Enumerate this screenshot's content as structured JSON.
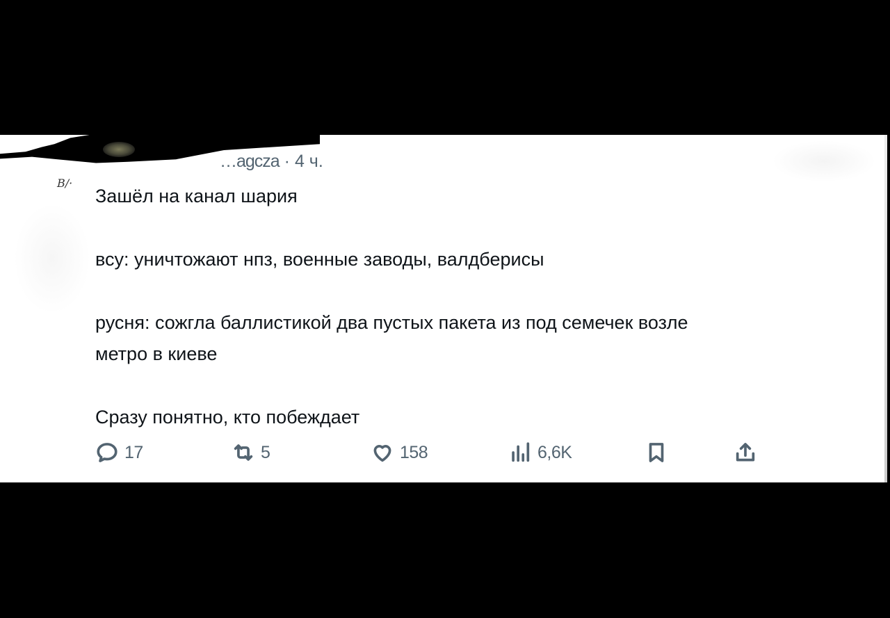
{
  "tweet": {
    "handle_fragment": "…agcza",
    "separator": "·",
    "time": "4 ч.",
    "scribble": "B/·",
    "lines": [
      "Зашёл на канал шария",
      "всу: уничтожают нпз, военные заводы, валдберисы",
      "русня: сожгла баллистикой два пустых пакета из под семечек  возле",
      "метро в киеве",
      "Сразу понятно, кто побеждает"
    ]
  },
  "actions": {
    "reply": {
      "icon": "reply-icon",
      "count": "17"
    },
    "repost": {
      "icon": "repost-icon",
      "count": "5"
    },
    "like": {
      "icon": "heart-icon",
      "count": "158"
    },
    "views": {
      "icon": "views-icon",
      "count": "6,6K"
    },
    "bookmark": {
      "icon": "bookmark-icon"
    },
    "share": {
      "icon": "share-icon"
    }
  },
  "colors": {
    "text": "#0f1419",
    "muted": "#536471",
    "background": "#ffffff",
    "letterbox": "#000000"
  }
}
